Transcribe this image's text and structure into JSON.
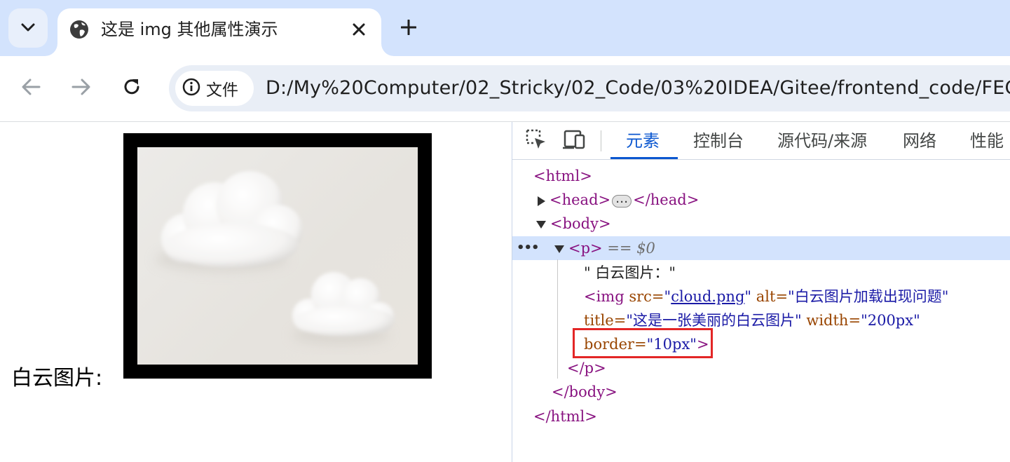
{
  "browser": {
    "tab": {
      "title": "这是 img 其他属性演示"
    },
    "address": {
      "chip_label": "文件",
      "url": "D:/My%20Computer/02_Stricky/02_Code/03%20IDEA/Gitee/frontend_code/FEC"
    }
  },
  "page": {
    "paragraph_label": "白云图片:",
    "image_alt": "白云图片加载出现问题",
    "image_title": "这是一张美丽的白云图片"
  },
  "devtools": {
    "tabs": [
      "元素",
      "控制台",
      "源代码/来源",
      "网络",
      "性能"
    ],
    "active_tab": "元素",
    "dom": {
      "html_open": "<html>",
      "head_open": "<head>",
      "head_close": "</head>",
      "body_open": "<body>",
      "p_open": "<p>",
      "selected_marker": "== $0",
      "text_node": "\" 白云图片：\"",
      "img_open": "<img",
      "src_attr": "src=",
      "src_q1": "\"",
      "src_value": "cloud.png",
      "src_q2": "\"",
      "alt_attr": "alt=",
      "alt_value": "\"白云图片加载出现问题\"",
      "title_attr": "title=",
      "title_value": "\"这是一张美丽的白云图片\"",
      "width_attr": "width=",
      "width_value": "\"200px\"",
      "border_attr": "border=",
      "border_value": "\"10px\"",
      "img_close": ">",
      "p_close": "</p>",
      "body_close": "</body>",
      "html_close": "</html>"
    }
  },
  "colors": {
    "tabstrip": "#d3e3fd",
    "tag": "#881280",
    "attr_name": "#994500",
    "attr_value": "#1a1aa6",
    "selection": "#d3e3fd",
    "highlight": "#e32626"
  }
}
